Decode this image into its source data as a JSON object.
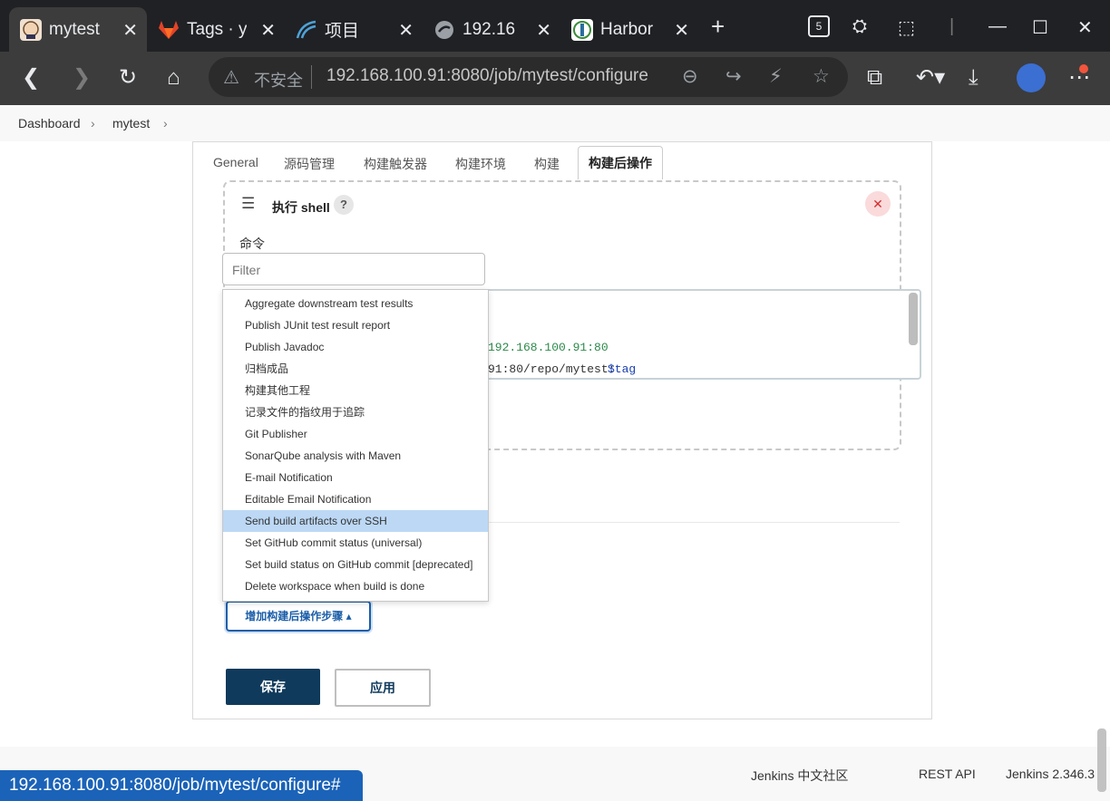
{
  "browser": {
    "tabs": [
      {
        "title": "mytest",
        "icon": "jenkins-icon",
        "active": true
      },
      {
        "title": "Tags · y",
        "icon": "gitlab-icon"
      },
      {
        "title": "项目",
        "icon": "rancher-icon"
      },
      {
        "title": "192.16",
        "icon": "globe-icon"
      },
      {
        "title": "Harbor",
        "icon": "harbor-icon"
      }
    ],
    "new_tab": "+",
    "tab_count": "5",
    "address": {
      "security_label": "不安全",
      "url": "192.168.100.91:8080/job/mytest/configure"
    }
  },
  "breadcrumb": {
    "items": [
      "Dashboard",
      "mytest"
    ]
  },
  "config_tabs": [
    "General",
    "源码管理",
    "构建触发器",
    "构建环境",
    "构建",
    "构建后操作"
  ],
  "shell_step": {
    "title": "执行 shell",
    "help": "?",
    "command_label": "命令",
    "code_lines": [
      "192.168.100.91:80",
      "91:80/repo/mytest:",
      "$tag"
    ]
  },
  "filter": {
    "placeholder": "Filter"
  },
  "dropdown": {
    "items": [
      "Aggregate downstream test results",
      "Publish JUnit test result report",
      "Publish Javadoc",
      "归档成品",
      "构建其他工程",
      "记录文件的指纹用于追踪",
      "Git Publisher",
      "SonarQube analysis with Maven",
      "E-mail Notification",
      "Editable Email Notification",
      "Send build artifacts over SSH",
      "Set GitHub commit status (universal)",
      "Set build status on GitHub commit [deprecated]",
      "Delete workspace when build is done"
    ],
    "highlighted": "Send build artifacts over SSH"
  },
  "buttons": {
    "add_post_build": "增加构建后操作步骤",
    "save": "保存",
    "apply": "应用"
  },
  "footer": {
    "community": "Jenkins 中文社区",
    "rest_api": "REST API",
    "version": "Jenkins 2.346.3"
  },
  "status_url": "192.168.100.91:8080/job/mytest/configure#",
  "colors": {
    "accent": "#1b5ea8",
    "save_bg": "#0f3a5c",
    "highlight": "#bcd8f5",
    "status_bar": "#1b63b8"
  }
}
